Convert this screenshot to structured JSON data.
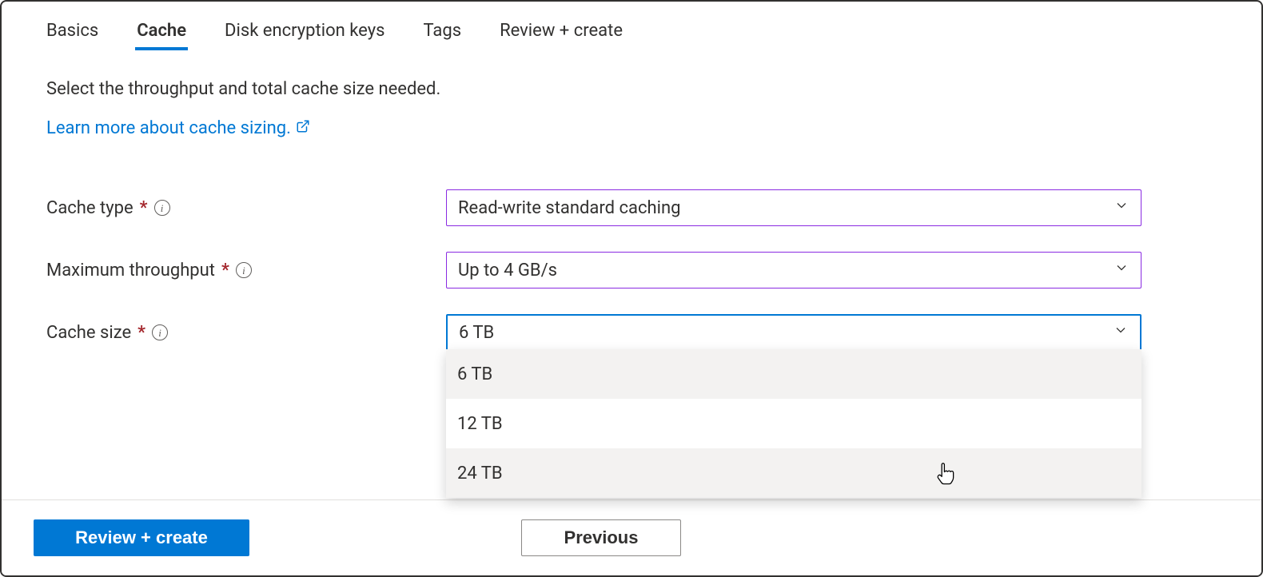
{
  "tabs": {
    "items": [
      {
        "label": "Basics",
        "active": false
      },
      {
        "label": "Cache",
        "active": true
      },
      {
        "label": "Disk encryption keys",
        "active": false
      },
      {
        "label": "Tags",
        "active": false
      },
      {
        "label": "Review + create",
        "active": false
      }
    ]
  },
  "description": "Select the throughput and total cache size needed.",
  "learn_more": {
    "label": "Learn more about cache sizing."
  },
  "form": {
    "cache_type": {
      "label": "Cache type",
      "required": "*",
      "value": "Read-write standard caching"
    },
    "max_throughput": {
      "label": "Maximum throughput",
      "required": "*",
      "value": "Up to 4 GB/s"
    },
    "cache_size": {
      "label": "Cache size",
      "required": "*",
      "value": "6 TB",
      "options": [
        "6 TB",
        "12 TB",
        "24 TB"
      ]
    }
  },
  "footer": {
    "review_create": "Review + create",
    "previous": "Previous"
  }
}
